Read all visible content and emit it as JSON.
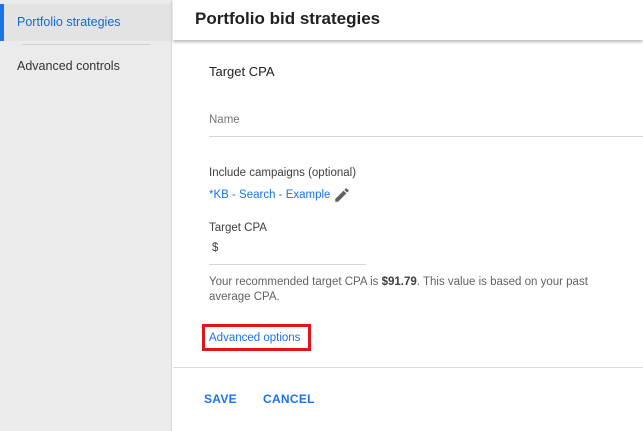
{
  "sidebar": {
    "items": [
      {
        "label": "Portfolio strategies",
        "active": true
      },
      {
        "label": "Advanced controls",
        "active": false
      }
    ]
  },
  "header": {
    "title": "Portfolio bid strategies"
  },
  "form": {
    "section_title": "Target CPA",
    "name_placeholder": "Name",
    "include_label": "Include campaigns (optional)",
    "campaign_value": "*KB - Search - Example",
    "edit_icon": "pencil-icon",
    "target_cpa_label": "Target CPA",
    "currency_symbol": "$",
    "recommend_prefix": "Your recommended target CPA is ",
    "recommend_value": "$91.79",
    "recommend_suffix": ". This value is based on your past average CPA.",
    "advanced_options": "Advanced options"
  },
  "footer": {
    "save_label": "SAVE",
    "cancel_label": "CANCEL"
  },
  "colors": {
    "accent": "#1a73e8",
    "highlight_box": "#e0151c",
    "sidebar_bg": "#ebebeb"
  }
}
